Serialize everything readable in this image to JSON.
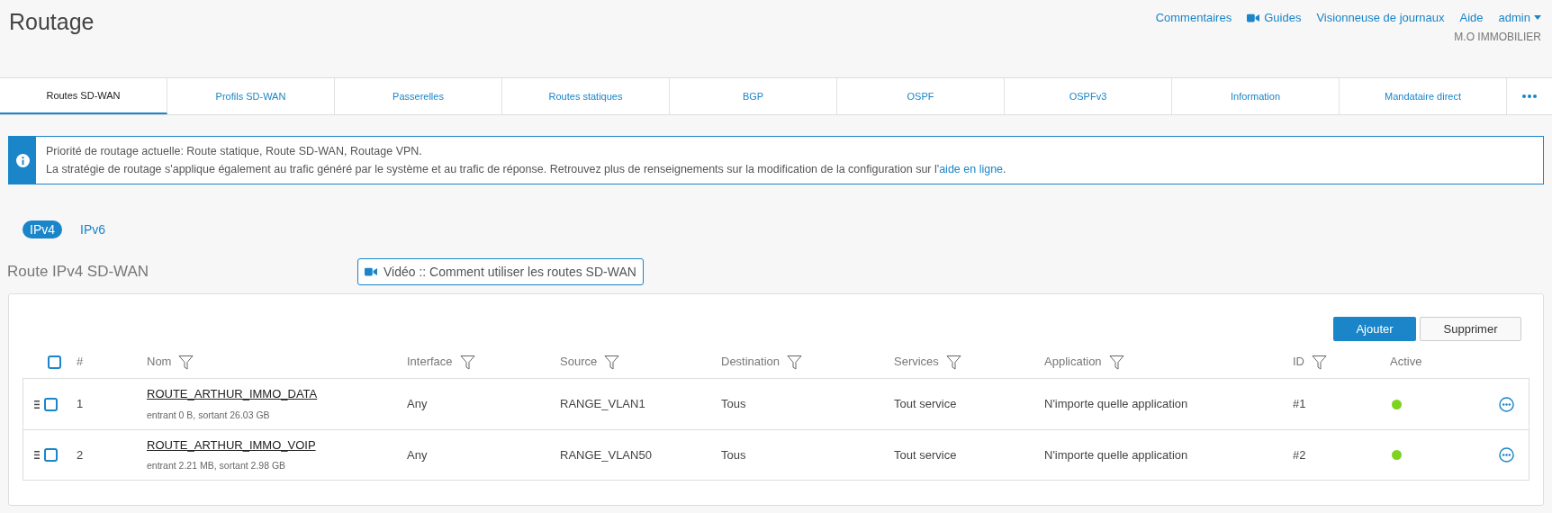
{
  "page": {
    "title": "Routage"
  },
  "header": {
    "links": [
      {
        "label": "Commentaires",
        "kind": "text"
      },
      {
        "label": "Guides",
        "kind": "video"
      },
      {
        "label": "Visionneuse de journaux",
        "kind": "text"
      },
      {
        "label": "Aide",
        "kind": "text"
      },
      {
        "label": "admin",
        "kind": "menu"
      }
    ],
    "company": "M.O IMMOBILIER"
  },
  "tabs": [
    {
      "label": "Routes SD-WAN",
      "selected": true
    },
    {
      "label": "Profils SD-WAN",
      "selected": false
    },
    {
      "label": "Passerelles",
      "selected": false
    },
    {
      "label": "Routes statiques",
      "selected": false
    },
    {
      "label": "BGP",
      "selected": false
    },
    {
      "label": "OSPF",
      "selected": false
    },
    {
      "label": "OSPFv3",
      "selected": false
    },
    {
      "label": "Information",
      "selected": false
    },
    {
      "label": "Mandataire direct",
      "selected": false
    }
  ],
  "info": {
    "line1": "Priorité de routage actuelle: Route statique, Route SD-WAN, Routage VPN.",
    "line2": "La stratégie de routage s'applique également au trafic généré par le système et au trafic de réponse. Retrouvez plus de renseignements sur la modification de la configuration sur l'",
    "link": "aide en ligne",
    "end": "."
  },
  "ip_tabs": [
    {
      "label": "IPv4",
      "selected": true
    },
    {
      "label": "IPv6",
      "selected": false
    }
  ],
  "section": {
    "title": "Route IPv4 SD-WAN",
    "video_button": "Vidéo :: Comment utiliser les routes SD-WAN"
  },
  "actions": {
    "add": "Ajouter",
    "delete": "Supprimer"
  },
  "table": {
    "select_all": {
      "checked": false
    },
    "columns": [
      {
        "label": "#",
        "filter": false
      },
      {
        "label": "Nom",
        "filter": true
      },
      {
        "label": "Interface",
        "filter": true
      },
      {
        "label": "Source",
        "filter": true
      },
      {
        "label": "Destination",
        "filter": true
      },
      {
        "label": "Services",
        "filter": true
      },
      {
        "label": "Application",
        "filter": true
      },
      {
        "label": "ID",
        "filter": true
      },
      {
        "label": "Active",
        "filter": false
      }
    ],
    "rows": [
      {
        "checked": false,
        "num": "1",
        "name": "ROUTE_ARTHUR_IMMO_DATA",
        "traffic": "entrant 0 B, sortant 26.03 GB",
        "interface": "Any",
        "source": "RANGE_VLAN1",
        "destination": "Tous",
        "services": "Tout service",
        "application": "N'importe quelle application",
        "id": "#1",
        "active": true
      },
      {
        "checked": false,
        "num": "2",
        "name": "ROUTE_ARTHUR_IMMO_VOIP",
        "traffic": "entrant 2.21 MB, sortant 2.98 GB",
        "interface": "Any",
        "source": "RANGE_VLAN50",
        "destination": "Tous",
        "services": "Tout service",
        "application": "N'importe quelle application",
        "id": "#2",
        "active": true
      }
    ]
  }
}
